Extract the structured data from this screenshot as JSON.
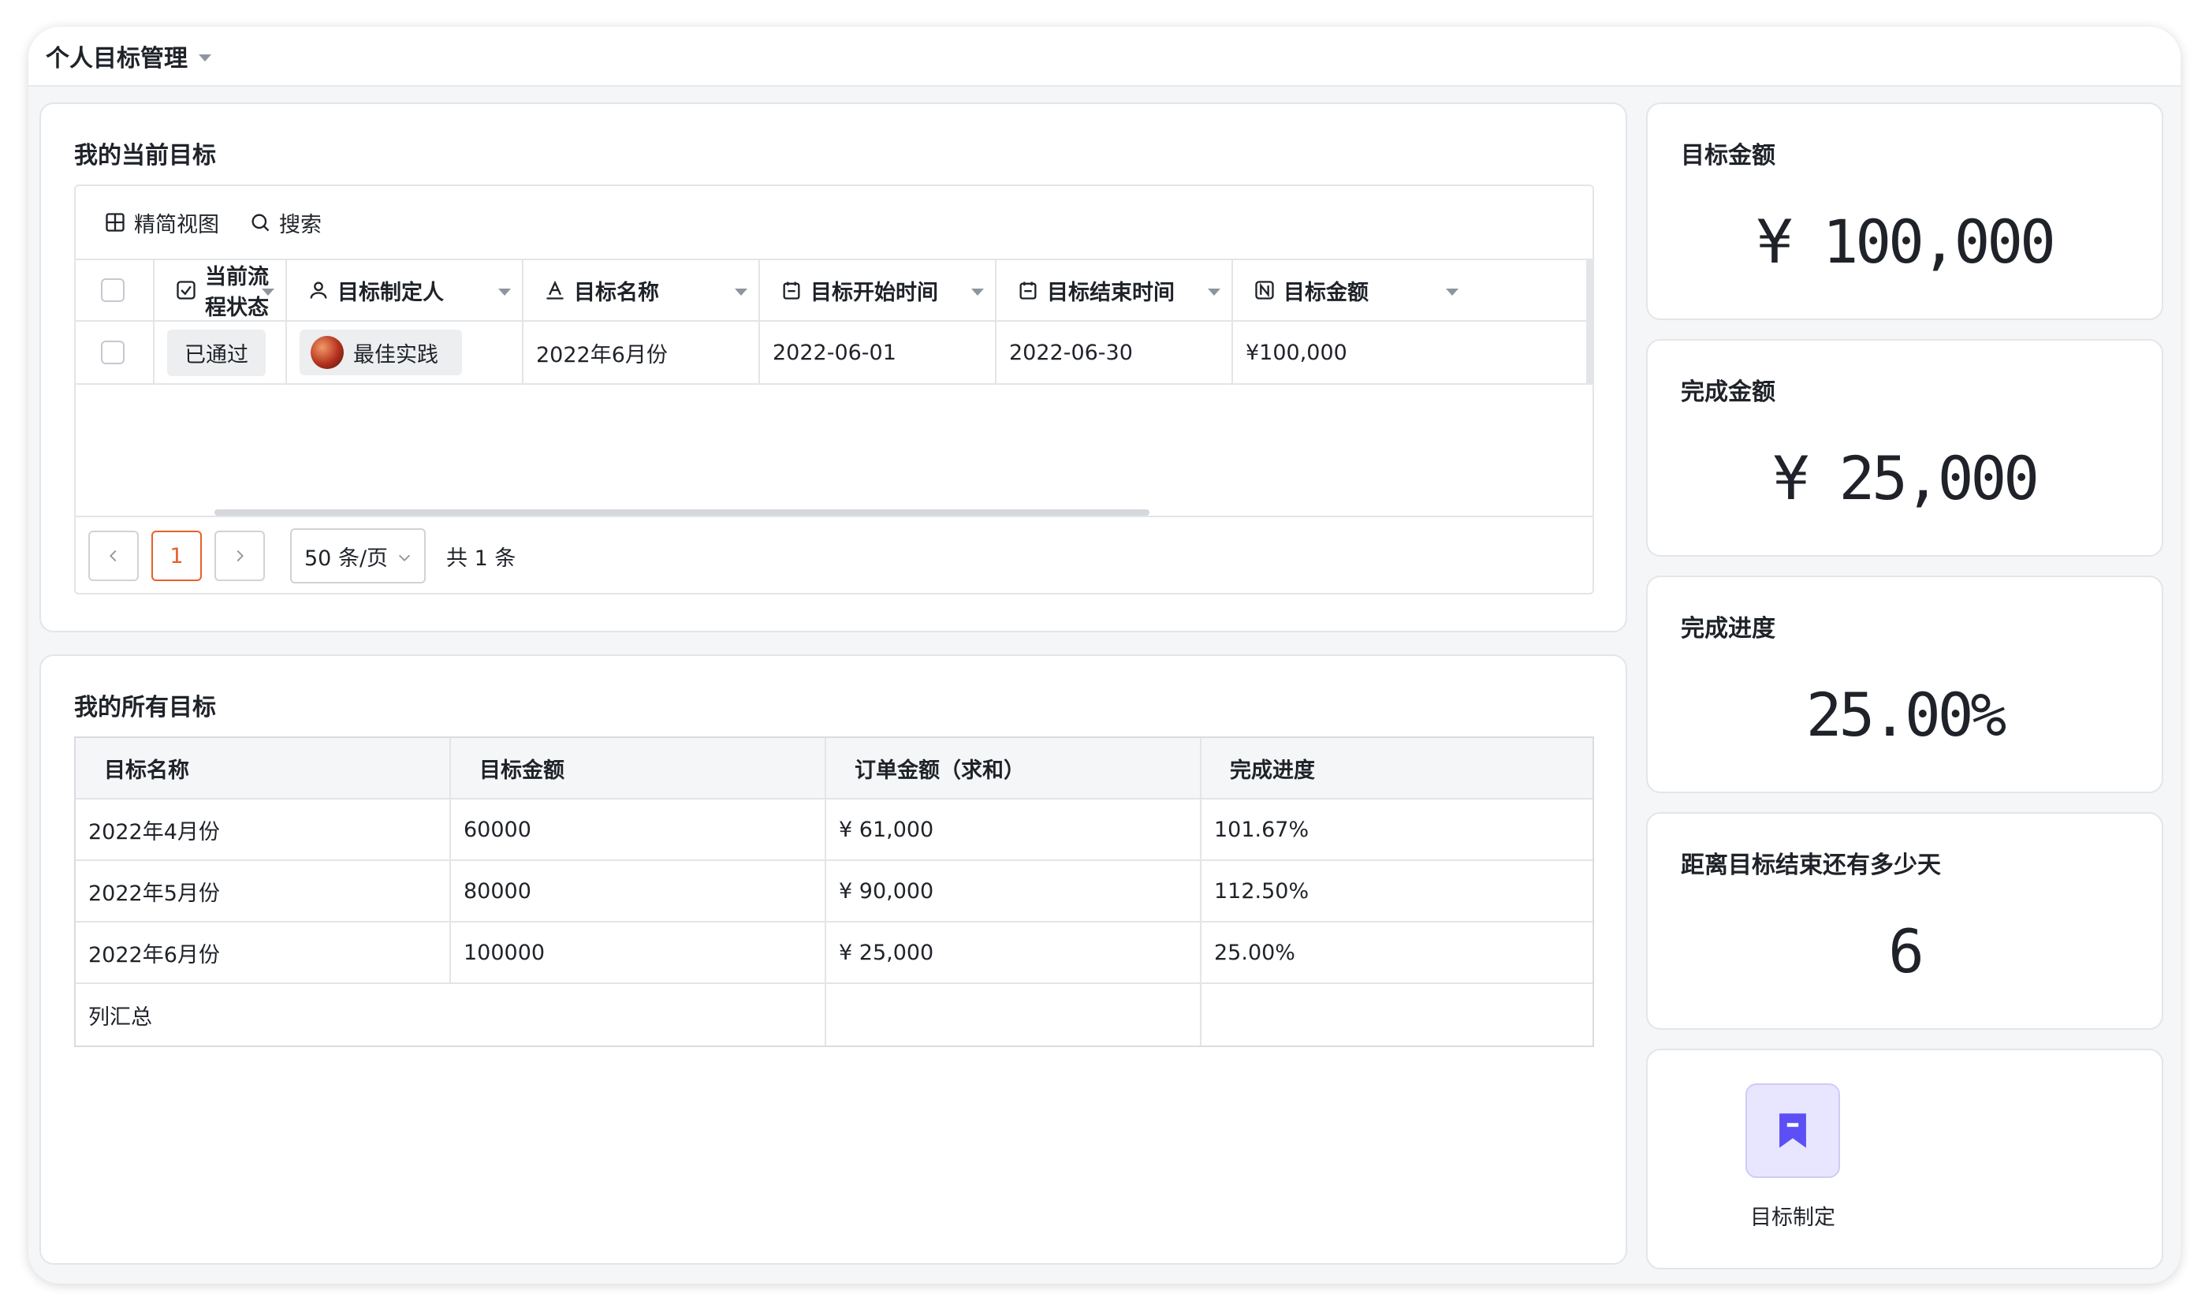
{
  "app": {
    "title": "个人目标管理"
  },
  "current": {
    "title": "我的当前目标",
    "toolbar": {
      "view_label": "精简视图",
      "search_label": "搜索"
    },
    "columns": [
      "当前流程状态",
      "目标制定人",
      "目标名称",
      "目标开始时间",
      "目标结束时间",
      "目标金额"
    ],
    "row": {
      "status": "已通过",
      "owner": "最佳实践",
      "name": "2022年6月份",
      "start": "2022-06-01",
      "end": "2022-06-30",
      "amount": "¥100,000"
    },
    "pager": {
      "page": "1",
      "page_size": "50 条/页",
      "total": "共 1 条"
    }
  },
  "all": {
    "title": "我的所有目标",
    "columns": [
      "目标名称",
      "目标金额",
      "订单金额（求和）",
      "完成进度"
    ],
    "rows": [
      [
        "2022年4月份",
        "60000",
        "¥ 61,000",
        "101.67%"
      ],
      [
        "2022年5月份",
        "80000",
        "¥ 90,000",
        "112.50%"
      ],
      [
        "2022年6月份",
        "100000",
        "¥ 25,000",
        "25.00%"
      ]
    ],
    "summary_label": "列汇总"
  },
  "stats": {
    "target": {
      "title": "目标金额",
      "value": "¥ 100,000"
    },
    "done": {
      "title": "完成金额",
      "value": "¥ 25,000"
    },
    "progress": {
      "title": "完成进度",
      "value": "25.00%"
    },
    "days": {
      "title": "距离目标结束还有多少天",
      "value": "6"
    }
  },
  "action": {
    "label": "目标制定",
    "icon": "bookmark-icon",
    "accent": "#5b4ff5"
  },
  "colors": {
    "accent_orange": "#e8602c",
    "tag_bg": "#eceef0"
  }
}
